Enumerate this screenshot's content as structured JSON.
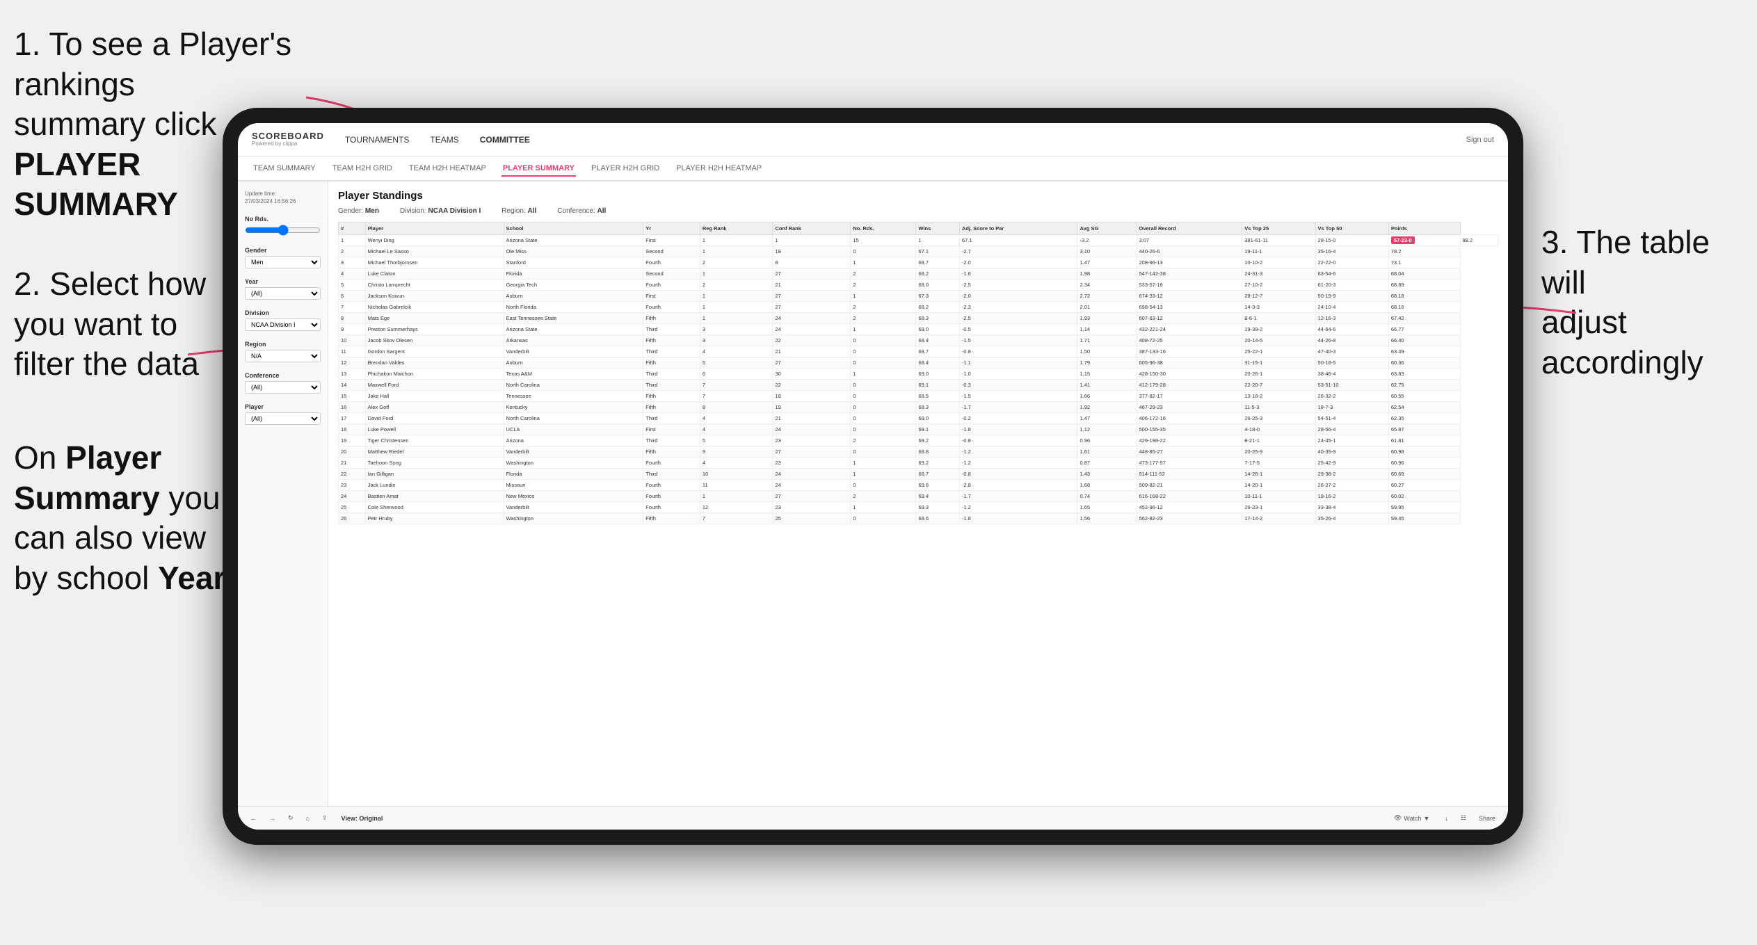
{
  "annotations": {
    "top_left_line1": "1. To see a Player's rankings",
    "top_left_line2": "summary click ",
    "top_left_bold": "PLAYER SUMMARY",
    "mid_left_line1": "2. Select how",
    "mid_left_line2": "you want to",
    "mid_left_line3": "filter the data",
    "bottom_left_line1": "On ",
    "bottom_left_bold1": "Player",
    "bottom_left_line2": "Summary",
    "bottom_left_after": " you",
    "bottom_left_line3": "can also view",
    "bottom_left_line4": "by school ",
    "bottom_left_bold2": "Year",
    "right_line1": "3. The table will",
    "right_line2": "adjust accordingly"
  },
  "nav": {
    "logo": "SCOREBOARD",
    "logo_sub": "Powered by clippa",
    "links": [
      "TOURNAMENTS",
      "TEAMS",
      "COMMITTEE"
    ],
    "sign_out": "Sign out"
  },
  "sub_nav": {
    "links": [
      "TEAM SUMMARY",
      "TEAM H2H GRID",
      "TEAM H2H HEATMAP",
      "PLAYER SUMMARY",
      "PLAYER H2H GRID",
      "PLAYER H2H HEATMAP"
    ]
  },
  "sidebar": {
    "update_label": "Update time:",
    "update_time": "27/03/2024 16:56:26",
    "no_rds_label": "No Rds.",
    "gender_label": "Gender",
    "gender_value": "Men",
    "year_label": "Year",
    "year_value": "(All)",
    "division_label": "Division",
    "division_value": "NCAA Division I",
    "region_label": "Region",
    "region_value": "N/A",
    "conference_label": "Conference",
    "conference_value": "(All)",
    "player_label": "Player",
    "player_value": "(All)"
  },
  "table": {
    "title": "Player Standings",
    "filters": {
      "gender_label": "Gender:",
      "gender_value": "Men",
      "division_label": "Division:",
      "division_value": "NCAA Division I",
      "region_label": "Region:",
      "region_value": "All",
      "conference_label": "Conference:",
      "conference_value": "All"
    },
    "headers": [
      "#",
      "Player",
      "School",
      "Yr",
      "Reg Rank",
      "Conf Rank",
      "No. Rds.",
      "Wins",
      "Adj. Score to Par",
      "Avg SG",
      "Overall Record",
      "Vs Top 25",
      "Vs Top 50",
      "Points"
    ],
    "rows": [
      [
        "1",
        "Wenyi Ding",
        "Arizona State",
        "First",
        "1",
        "1",
        "15",
        "1",
        "67.1",
        "-3.2",
        "3.07",
        "381-61-11",
        "28-15-0",
        "57-23-0",
        "88.2"
      ],
      [
        "2",
        "Michael Le Sasso",
        "Ole Miss",
        "Second",
        "1",
        "18",
        "0",
        "67.1",
        "-2.7",
        "3.10",
        "440-26-6",
        "19-11-1",
        "35-16-4",
        "78.2"
      ],
      [
        "3",
        "Michael Thorbjornsen",
        "Stanford",
        "Fourth",
        "2",
        "8",
        "1",
        "68.7",
        "-2.0",
        "1.47",
        "208-96-13",
        "10-10-2",
        "22-22-0",
        "73.1"
      ],
      [
        "4",
        "Luke Claton",
        "Florida",
        "Second",
        "1",
        "27",
        "2",
        "68.2",
        "-1.6",
        "1.98",
        "547-142-38",
        "24-31-3",
        "63-54-6",
        "68.04"
      ],
      [
        "5",
        "Christo Lamprecht",
        "Georgia Tech",
        "Fourth",
        "2",
        "21",
        "2",
        "68.0",
        "-2.5",
        "2.34",
        "533-57-16",
        "27-10-2",
        "61-20-3",
        "68.89"
      ],
      [
        "6",
        "Jackson Koivun",
        "Auburn",
        "First",
        "1",
        "27",
        "1",
        "67.3",
        "-2.0",
        "2.72",
        "674-33-12",
        "28-12-7",
        "50-19-9",
        "68.18"
      ],
      [
        "7",
        "Nicholas Gabrelcik",
        "North Florida",
        "Fourth",
        "1",
        "27",
        "2",
        "68.2",
        "-2.3",
        "2.01",
        "698-54-13",
        "14-3-3",
        "24-10-4",
        "68.16"
      ],
      [
        "8",
        "Mats Ege",
        "East Tennessee State",
        "Fifth",
        "1",
        "24",
        "2",
        "68.3",
        "-2.5",
        "1.93",
        "607-63-12",
        "8-6-1",
        "12-16-3",
        "67.42"
      ],
      [
        "9",
        "Preston Summerhays",
        "Arizona State",
        "Third",
        "3",
        "24",
        "1",
        "69.0",
        "-0.5",
        "1.14",
        "432-221-24",
        "19-39-2",
        "44-64-6",
        "66.77"
      ],
      [
        "10",
        "Jacob Skov Olesen",
        "Arkansas",
        "Fifth",
        "3",
        "22",
        "0",
        "68.4",
        "-1.5",
        "1.71",
        "408-72-25",
        "20-14-5",
        "44-26-8",
        "66.40"
      ],
      [
        "11",
        "Gordon Sargent",
        "Vanderbilt",
        "Third",
        "4",
        "21",
        "0",
        "68.7",
        "-0.8",
        "1.50",
        "387-133-16",
        "25-22-1",
        "47-40-3",
        "63.49"
      ],
      [
        "12",
        "Brendan Valdes",
        "Auburn",
        "Fifth",
        "5",
        "27",
        "0",
        "68.4",
        "-1.1",
        "1.79",
        "605-96-38",
        "31-15-1",
        "50-18-5",
        "60.36"
      ],
      [
        "13",
        "Phichakon Maichon",
        "Texas A&M",
        "Third",
        "6",
        "30",
        "1",
        "69.0",
        "-1.0",
        "1.15",
        "428-150-30",
        "20-26-1",
        "38-46-4",
        "63.83"
      ],
      [
        "14",
        "Maxwell Ford",
        "North Carolina",
        "Third",
        "7",
        "22",
        "0",
        "69.1",
        "-0.3",
        "1.41",
        "412-179-28",
        "22-20-7",
        "53-51-10",
        "62.75"
      ],
      [
        "15",
        "Jake Hall",
        "Tennessee",
        "Fifth",
        "7",
        "18",
        "0",
        "68.5",
        "-1.5",
        "1.66",
        "377-82-17",
        "13-18-2",
        "26-32-2",
        "60.55"
      ],
      [
        "16",
        "Alex Goff",
        "Kentucky",
        "Fifth",
        "8",
        "19",
        "0",
        "68.3",
        "-1.7",
        "1.92",
        "467-29-23",
        "11-5-3",
        "18-7-3",
        "62.54"
      ],
      [
        "17",
        "David Ford",
        "North Carolina",
        "Third",
        "4",
        "21",
        "0",
        "69.0",
        "-0.2",
        "1.47",
        "406-172-16",
        "26-25-3",
        "54-51-4",
        "62.35"
      ],
      [
        "18",
        "Luke Powell",
        "UCLA",
        "First",
        "4",
        "24",
        "0",
        "69.1",
        "-1.8",
        "1.12",
        "500-155-35",
        "4-18-0",
        "28-56-4",
        "65.87"
      ],
      [
        "19",
        "Tiger Christensen",
        "Arizona",
        "Third",
        "5",
        "23",
        "2",
        "69.2",
        "-0.8",
        "0.96",
        "429-198-22",
        "8-21-1",
        "24-45-1",
        "61.81"
      ],
      [
        "20",
        "Matthew Riedel",
        "Vanderbilt",
        "Fifth",
        "9",
        "27",
        "0",
        "68.8",
        "-1.2",
        "1.61",
        "448-85-27",
        "20-25-9",
        "40-35-9",
        "60.98"
      ],
      [
        "21",
        "Taehoon Song",
        "Washington",
        "Fourth",
        "4",
        "23",
        "1",
        "69.2",
        "-1.2",
        "0.87",
        "473-177-57",
        "7-17-5",
        "25-42-9",
        "60.96"
      ],
      [
        "22",
        "Ian Gilligan",
        "Florida",
        "Third",
        "10",
        "24",
        "1",
        "68.7",
        "-0.8",
        "1.43",
        "514-111-52",
        "14-26-1",
        "29-38-2",
        "60.69"
      ],
      [
        "23",
        "Jack Lundin",
        "Missouri",
        "Fourth",
        "11",
        "24",
        "0",
        "69.6",
        "-2.8",
        "1.68",
        "509-82-21",
        "14-20-1",
        "26-27-2",
        "60.27"
      ],
      [
        "24",
        "Bastien Amat",
        "New Mexico",
        "Fourth",
        "1",
        "27",
        "2",
        "69.4",
        "-1.7",
        "0.74",
        "616-168-22",
        "10-11-1",
        "19-16-2",
        "60.02"
      ],
      [
        "25",
        "Cole Sherwood",
        "Vanderbilt",
        "Fourth",
        "12",
        "23",
        "1",
        "69.3",
        "-1.2",
        "1.65",
        "452-96-12",
        "26-23-1",
        "33-38-4",
        "59.95"
      ],
      [
        "26",
        "Petr Hruby",
        "Washington",
        "Fifth",
        "7",
        "25",
        "0",
        "68.6",
        "-1.8",
        "1.56",
        "562-82-23",
        "17-14-2",
        "35-26-4",
        "59.45"
      ]
    ]
  },
  "toolbar": {
    "view_label": "View: Original",
    "watch_label": "Watch",
    "share_label": "Share"
  }
}
